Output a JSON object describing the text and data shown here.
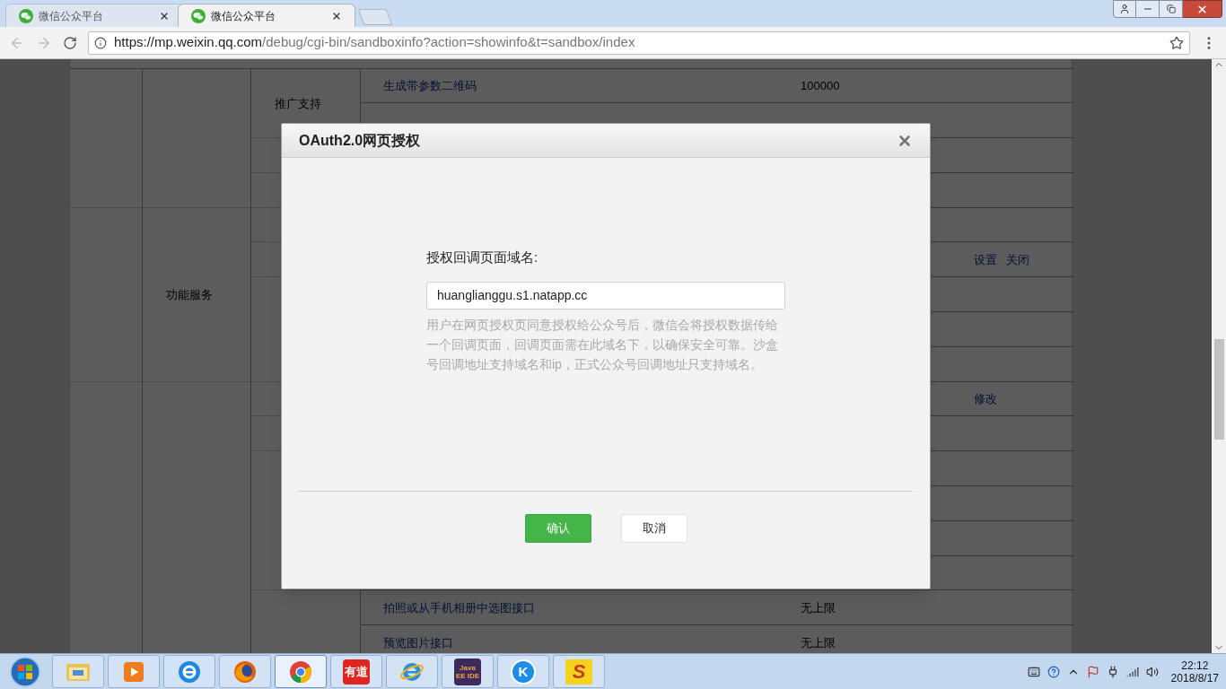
{
  "browser": {
    "tabs": [
      {
        "title": "微信公众平台",
        "selected": false
      },
      {
        "title": "微信公众平台",
        "selected": true
      }
    ],
    "url_host": "https://mp.weixin.qq.com",
    "url_path": "/debug/cgi-bin/sandboxinfo?action=showinfo&t=sandbox/index"
  },
  "page_table": {
    "categories": [
      {
        "groups": [
          {
            "name": "推广支持",
            "rows": [
              {
                "api": "生成带参数二维码",
                "limit": "100000"
              },
              {}
            ]
          },
          {
            "rows": [
              {}
            ]
          },
          {
            "rows": [
              {}
            ]
          }
        ]
      },
      {
        "name": "功能服务",
        "groups": [
          {
            "rows": [
              {}
            ]
          },
          {
            "rows": [
              {
                "actions": [
                  "设置",
                  "关闭"
                ]
              }
            ]
          },
          {
            "rows": [
              {},
              {},
              {}
            ]
          }
        ]
      },
      {
        "groups": [
          {
            "rows": [
              {
                "actions": [
                  "修改"
                ]
              }
            ]
          },
          {
            "rows": [
              {}
            ]
          },
          {
            "rows": [
              {},
              {},
              {},
              {}
            ]
          },
          {
            "rows": [
              {
                "api": "拍照或从手机相册中选图接口",
                "limit": "无上限"
              },
              {
                "api": "预览图片接口",
                "limit": "无上限"
              }
            ]
          }
        ]
      }
    ]
  },
  "dialog": {
    "title": "OAuth2.0网页授权",
    "field_label": "授权回调页面域名:",
    "field_value": "huanglianggu.s1.natapp.cc",
    "hint": "用户在网页授权页同意授权给公众号后，微信会将授权数据传给一个回调页面，回调页面需在此域名下，以确保安全可靠。沙盒号回调地址支持域名和ip，正式公众号回调地址只支持域名。",
    "buttons": [
      {
        "label": "确认",
        "kind": "primary"
      },
      {
        "label": "取消",
        "kind": "default"
      }
    ]
  },
  "taskbar": {
    "items": [
      {
        "kind": "folder",
        "selected": false
      },
      {
        "kind": "media",
        "selected": false
      },
      {
        "kind": "ie-blue",
        "selected": false
      },
      {
        "kind": "firefox",
        "selected": false
      },
      {
        "kind": "chrome",
        "selected": true
      },
      {
        "kind": "youdao",
        "label": "有道",
        "selected": false
      },
      {
        "kind": "ie",
        "selected": false
      },
      {
        "kind": "eclipse",
        "label": "Java EE IDE",
        "selected": false
      },
      {
        "kind": "kugou",
        "label": "K",
        "selected": false
      },
      {
        "kind": "sublime",
        "label": "S",
        "selected": false
      }
    ],
    "time": "22:12",
    "date": "2018/8/17"
  }
}
